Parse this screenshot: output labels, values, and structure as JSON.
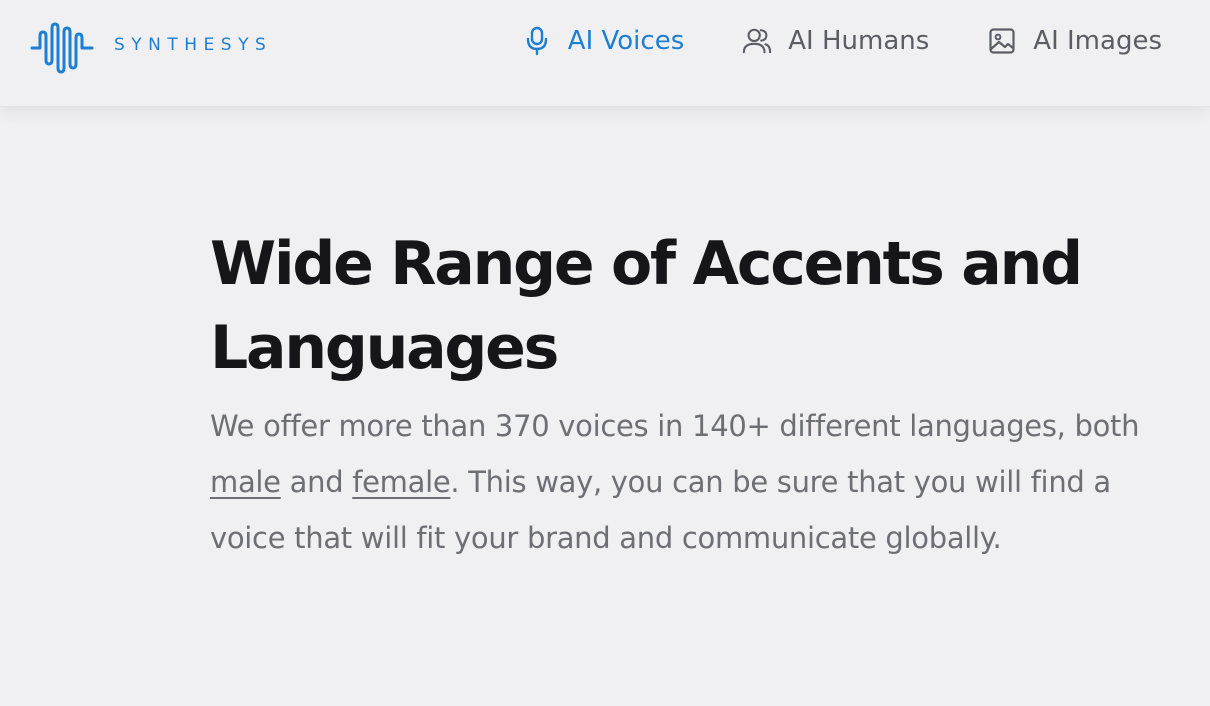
{
  "brand": {
    "name": "SYNTHESYS",
    "color": "#1c7fd4"
  },
  "nav": {
    "items": [
      {
        "label": "AI Voices",
        "icon": "microphone-icon",
        "active": true
      },
      {
        "label": "AI Humans",
        "icon": "users-icon",
        "active": false
      },
      {
        "label": "AI Images",
        "icon": "image-icon",
        "active": false
      }
    ]
  },
  "hero": {
    "title": "Wide Range of Accents and Languages",
    "desc_part1": "We offer more than 370 voices in 140+ different languages, both ",
    "link_male": "male",
    "desc_part2": " and ",
    "link_female": "female",
    "desc_part3": ". This way, you can be sure that you will find a voice that will fit your brand and communicate globally."
  },
  "colors": {
    "accent": "#1c7fd4",
    "background": "#f0f0f2",
    "heading": "#15151a",
    "body_text": "#6e6e76",
    "nav_text": "#5c5c66"
  }
}
